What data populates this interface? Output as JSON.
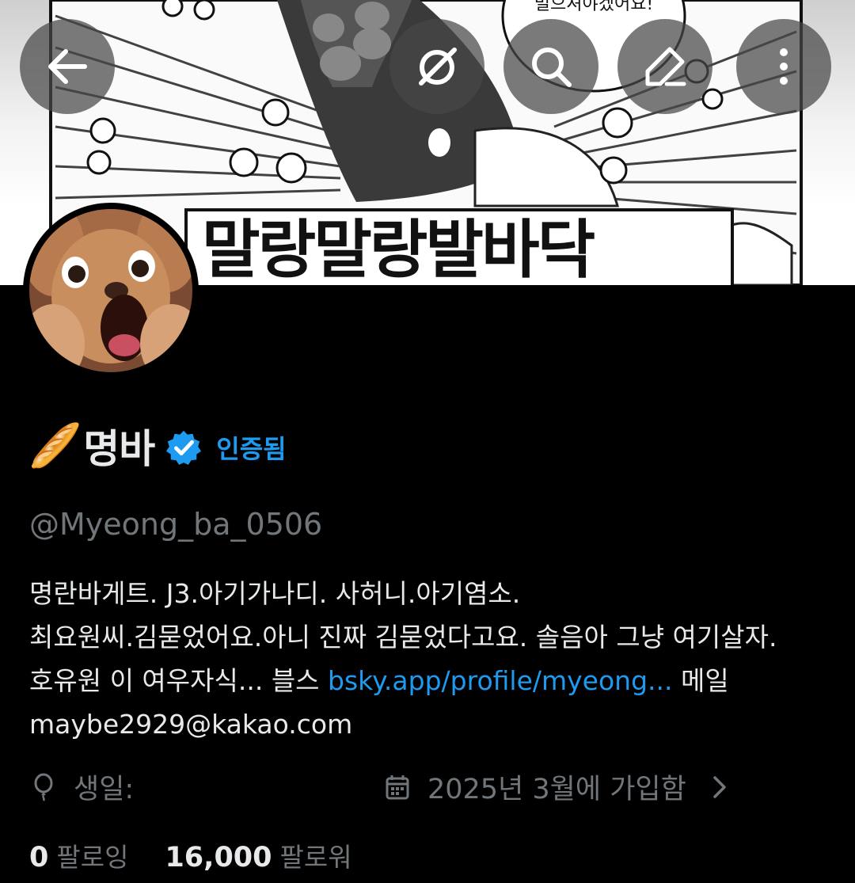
{
  "header": {
    "banner_caption": "말랑말랑발바닥",
    "banner_speech_text": "밀으셔야겠어요!",
    "icons": [
      "back-arrow-icon",
      "grok-icon",
      "search-icon",
      "edit-icon",
      "more-vertical-icon"
    ]
  },
  "profile": {
    "emoji": "🥖",
    "name": "명바",
    "verified_label": "인증됨",
    "handle": "@Myeong_ba_0506",
    "bio": {
      "line1": "명란바게트. J3.아기가나디. 사허니.아기염소.",
      "line2": "최요원씨.김묻었어요.아니 진짜 김묻었다고요. 솔음아 그냥 여기살자.",
      "line3_text": "호유원 이 여우자식... 블스 ",
      "line3_link": "bsky.app/profile/myeong...",
      "line3_tail": " 메일",
      "line4": "maybe2929@kakao.com"
    },
    "birthday_label": "생일:",
    "joined_label": "2025년 3월에 가입함",
    "following_count": "0",
    "following_label": "팔로잉",
    "followers_count": "16,000",
    "followers_label": "팔로워"
  },
  "colors": {
    "background": "#000000",
    "primary_text": "#e7e9ea",
    "secondary_text": "#71767b",
    "accent": "#1d9bf0"
  }
}
